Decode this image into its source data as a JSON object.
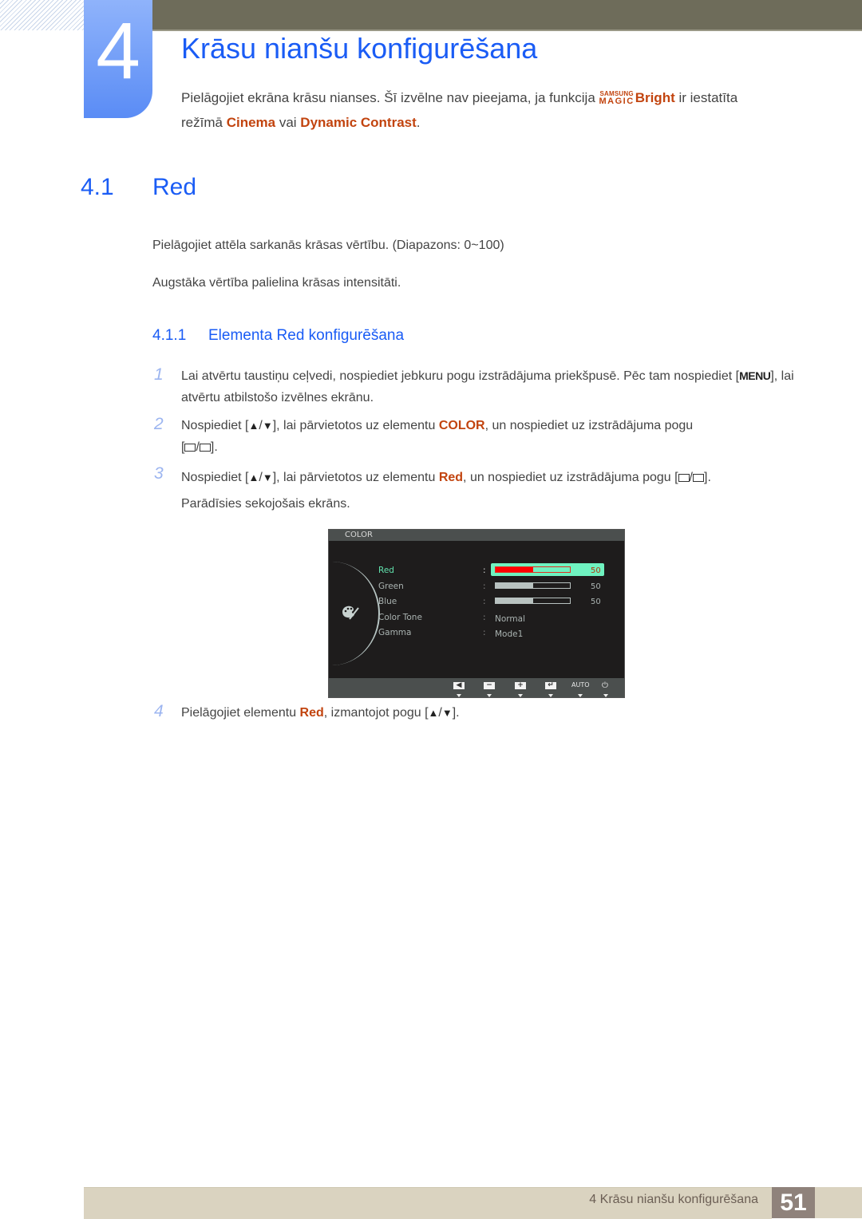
{
  "chapter": {
    "number": "4",
    "title": "Krāsu nianšu konfigurēšana",
    "intro_part1": "Pielāgojiet ekrāna krāsu nianses. Šī izvēlne nav pieejama, ja funkcija ",
    "magic_top": "SAMSUNG",
    "magic_bottom": "MAGIC",
    "magic_bright": "Bright",
    "intro_part2": " ir iestatīta",
    "intro_line2_a": "režīmā ",
    "cinema": "Cinema",
    "intro_line2_b": " vai ",
    "dynamic_contrast": "Dynamic Contrast",
    "intro_line2_c": "."
  },
  "section": {
    "number": "4.1",
    "title": "Red",
    "para1": "Pielāgojiet attēla sarkanās krāsas vērtību. (Diapazons: 0~100)",
    "para2": "Augstāka vērtība palielina krāsas intensitāti."
  },
  "subsection": {
    "number": "4.1.1",
    "title": "Elementa Red konfigurēšana"
  },
  "steps": [
    {
      "num": "1",
      "a": "Lai atvērtu taustiņu ceļvedi, nospiediet jebkuru pogu izstrādājuma priekšpusē. Pēc tam nospiediet [",
      "key": "MENU",
      "b": "], lai atvērtu atbilstošo izvēlnes ekrānu."
    },
    {
      "num": "2",
      "a": "Nospiediet [",
      "up": "▲",
      "slash": "/",
      "down": "▼",
      "b": "], lai pārvietotos uz elementu ",
      "highlight": "COLOR",
      "c": ", un nospiediet uz izstrādājuma pogu",
      "d_open": "[",
      "d_close": "]."
    },
    {
      "num": "3",
      "a": "Nospiediet [",
      "up": "▲",
      "slash": "/",
      "down": "▼",
      "b": "], lai pārvietotos uz elementu ",
      "highlight": "Red",
      "c": ", un nospiediet uz izstrādājuma pogu [",
      "d_close": "].",
      "line2": "Parādīsies sekojošais ekrāns."
    },
    {
      "num": "4",
      "a": "Pielāgojiet elementu ",
      "highlight": "Red",
      "b": ", izmantojot pogu [",
      "up": "▲",
      "slash": "/",
      "down": "▼",
      "c": "]."
    }
  ],
  "osd": {
    "header": "COLOR",
    "icon": "palette-icon",
    "rows": [
      {
        "label": "Red",
        "colon": ":",
        "value": 50,
        "value_text": "50",
        "type": "slider",
        "active": true
      },
      {
        "label": "Green",
        "colon": ":",
        "value": 50,
        "value_text": "50",
        "type": "slider",
        "active": false
      },
      {
        "label": "Blue",
        "colon": ":",
        "value": 50,
        "value_text": "50",
        "type": "slider",
        "active": false
      },
      {
        "label": "Color Tone",
        "colon": ":",
        "value_text": "Normal",
        "type": "text",
        "active": false
      },
      {
        "label": "Gamma",
        "colon": ":",
        "value_text": "Mode1",
        "type": "text",
        "active": false
      }
    ],
    "slider_max": 100,
    "footer_buttons": [
      {
        "name": "left-icon",
        "glyph": "◀"
      },
      {
        "name": "minus-icon",
        "glyph": "−"
      },
      {
        "name": "plus-icon",
        "glyph": "+"
      },
      {
        "name": "enter-icon",
        "glyph": "↵"
      },
      {
        "name": "auto-button",
        "glyph": "AUTO"
      },
      {
        "name": "power-icon",
        "glyph": "⏻"
      }
    ]
  },
  "footer": {
    "text": "4 Krāsu nianšu konfigurēšana",
    "page": "51"
  },
  "colors": {
    "heading_blue": "#1a5cf5",
    "accent_orange": "#c2440f",
    "osd_active": "#62e3ae",
    "osd_highlight": "#6ff2c0",
    "red_fill": "#ff0000"
  }
}
